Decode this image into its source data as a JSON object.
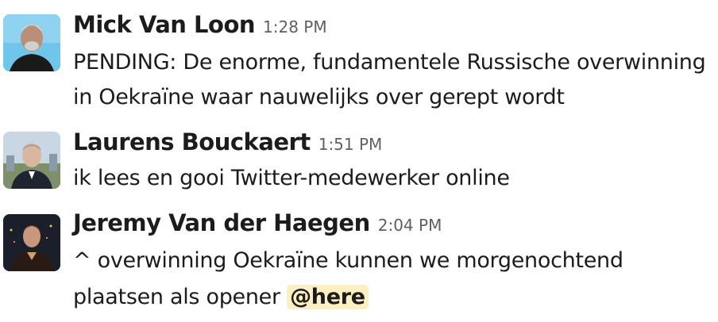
{
  "messages": [
    {
      "sender": "Mick Van Loon",
      "time": "1:28 PM",
      "avatar_icon": "user-avatar-photo",
      "lines": [
        "PENDING: De enorme, fundamentele Russische overwinning",
        "in Oekraïne waar nauwelijks over gerept wordt"
      ]
    },
    {
      "sender": "Laurens Bouckaert",
      "time": "1:51 PM",
      "avatar_icon": "user-avatar-photo",
      "lines": [
        "ik lees en gooi Twitter-medewerker online"
      ]
    },
    {
      "sender": "Jeremy Van der Haegen",
      "time": "2:04 PM",
      "avatar_icon": "user-avatar-photo",
      "lines": [
        "^ overwinning Oekraïne kunnen we morgenochtend",
        "plaatsen als opener"
      ],
      "mention": "@here"
    }
  ],
  "colors": {
    "text": "#1d1c1d",
    "timestamp": "#616061",
    "mention_bg": "#fcefc0"
  }
}
